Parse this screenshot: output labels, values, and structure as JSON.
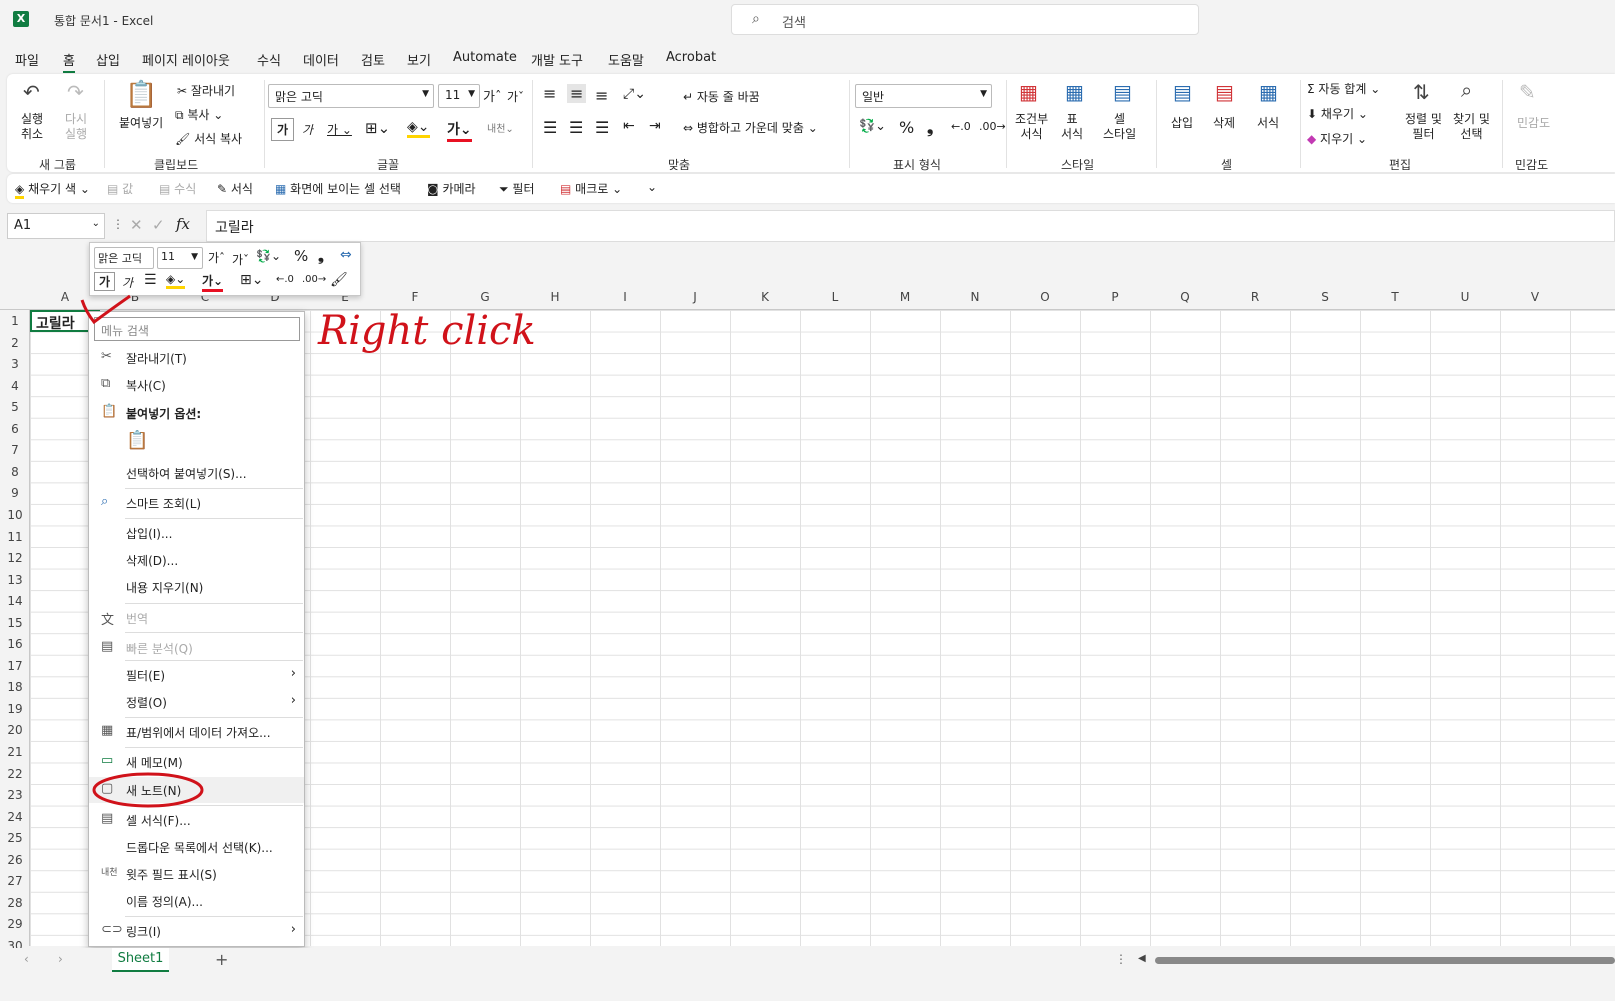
{
  "window": {
    "title": "통합 문서1  -  Excel",
    "search_placeholder": "검색"
  },
  "menu": [
    "파일",
    "홈",
    "삽입",
    "페이지 레이아웃",
    "수식",
    "데이터",
    "검토",
    "보기",
    "Automate",
    "개발 도구",
    "도움말",
    "Acrobat"
  ],
  "ribbon": {
    "undo": "실행\n취소",
    "redo": "다시\n실행",
    "new_group": "새 그룹",
    "paste": "붙여넣기",
    "cut": "잘라내기",
    "copy": "복사",
    "format_painter": "서식 복사",
    "clipboard": "클립보드",
    "font_name": "맑은 고딕",
    "font_size": "11",
    "font_group": "글꼴",
    "wrap": "자동 줄 바꿈",
    "merge": "병합하고 가운데 맞춤",
    "align_group": "맞춤",
    "number_format": "일반",
    "number_group": "표시 형식",
    "cond": "조건부\n서식",
    "table": "표\n서식",
    "cellstyle": "셀\n스타일",
    "style_group": "스타일",
    "insert": "삽입",
    "delete": "삭제",
    "format": "서식",
    "cells_group": "셀",
    "autosum": "자동 합계",
    "fill": "채우기",
    "clear": "지우기",
    "sort": "정렬 및\n필터",
    "find": "찾기 및\n선택",
    "edit_group": "편집",
    "sensitivity": "민감도"
  },
  "qat": {
    "fill_color": "채우기 색",
    "values": "값",
    "formula": "수식",
    "format": "서식",
    "visible_cells": "화면에 보이는 셀 선택",
    "camera": "카메라",
    "filter": "필터",
    "macro": "매크로"
  },
  "formula_bar": {
    "name_box": "A1",
    "value": "고릴라"
  },
  "columns": [
    "A",
    "B",
    "C",
    "D",
    "E",
    "F",
    "G",
    "H",
    "I",
    "J",
    "K",
    "L",
    "M",
    "N",
    "O",
    "P",
    "Q",
    "R",
    "S",
    "T",
    "U",
    "V"
  ],
  "rows": [
    "1",
    "2",
    "3",
    "4",
    "5",
    "6",
    "7",
    "8",
    "9",
    "10",
    "11",
    "12",
    "13",
    "14",
    "15",
    "16",
    "17",
    "18",
    "19",
    "20",
    "21",
    "22",
    "23",
    "24",
    "25",
    "26",
    "27",
    "28",
    "29",
    "30"
  ],
  "cell_a1": "고릴라",
  "mini_toolbar": {
    "font": "맑은 고딕",
    "size": "11"
  },
  "context_menu": {
    "search": "메뉴 검색",
    "items": [
      "잘라내기(T)",
      "복사(C)",
      "붙여넣기 옵션:",
      "선택하여 붙여넣기(S)...",
      "스마트 조회(L)",
      "삽입(I)...",
      "삭제(D)...",
      "내용 지우기(N)",
      "번역",
      "빠른 분석(Q)",
      "필터(E)",
      "정렬(O)",
      "표/범위에서 데이터 가져오...",
      "새 메모(M)",
      "새 노트(N)",
      "셀 서식(F)...",
      "드롭다운 목록에서 선택(K)...",
      "윗주 필드 표시(S)",
      "이름 정의(A)...",
      "링크(I)"
    ]
  },
  "sheet": {
    "tab": "Sheet1"
  },
  "annotation": {
    "text": "Right click",
    "color": "#d0121a"
  }
}
